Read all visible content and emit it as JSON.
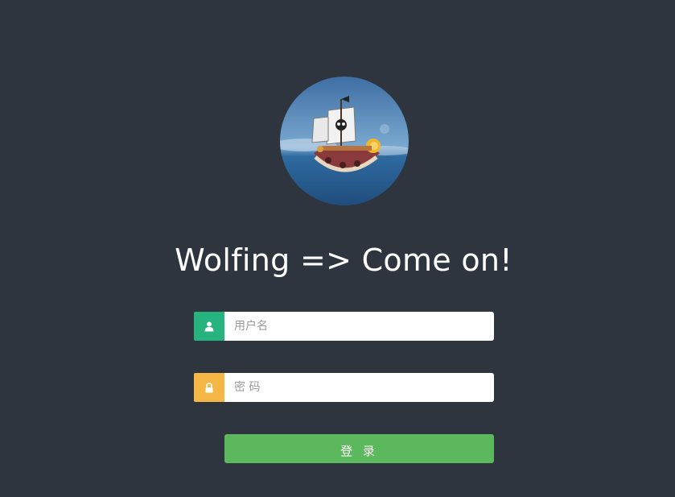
{
  "header": {
    "title": "Wolfing => Come on!"
  },
  "avatar": {
    "alt": "avatar-ship-image"
  },
  "form": {
    "username": {
      "placeholder": "用户名",
      "value": "",
      "icon": "user-icon",
      "icon_color": "#26b37e"
    },
    "password": {
      "placeholder": "密 码",
      "value": "",
      "icon": "lock-icon",
      "icon_color": "#f4b645"
    },
    "submit_label": "登 录",
    "submit_color": "#5cb85c"
  },
  "colors": {
    "background": "#2e353f"
  }
}
